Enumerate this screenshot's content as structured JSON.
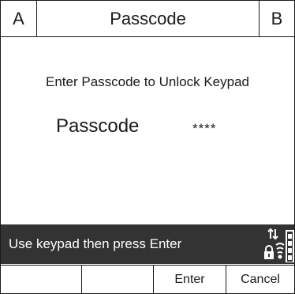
{
  "header": {
    "left_key": "A",
    "title": "Passcode",
    "right_key": "B"
  },
  "main": {
    "prompt": "Enter Passcode to Unlock Keypad",
    "passcode_label": "Passcode",
    "passcode_value": "****"
  },
  "status_bar": {
    "message": "Use keypad then press Enter",
    "icons": [
      "lock-icon",
      "transfer-arrows-icon",
      "wireless-signal-icon",
      "battery-icon"
    ],
    "background": "#333333"
  },
  "softkeys": [
    "",
    "",
    "Enter",
    "Cancel"
  ]
}
